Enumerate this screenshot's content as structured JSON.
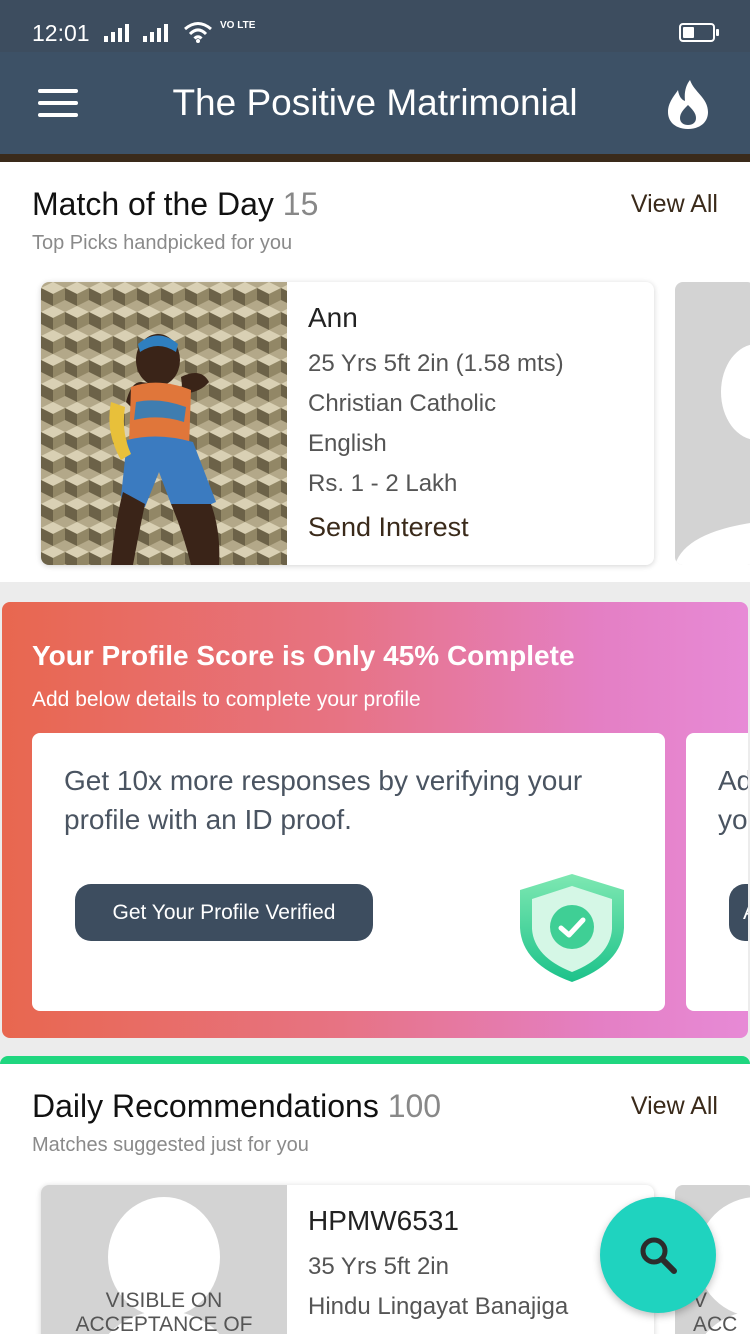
{
  "status_bar": {
    "time": "12:01",
    "network_label": "VO LTE",
    "battery_level": 0.4
  },
  "header": {
    "title": "The Positive Matrimonial"
  },
  "match_of_day": {
    "title": "Match of the Day",
    "count": "15",
    "subtitle": "Top Picks handpicked for you",
    "view_all": "View All",
    "profile": {
      "name": "Ann",
      "age_height": "25 Yrs 5ft 2in (1.58 mts)",
      "religion": "Christian Catholic",
      "language": "English",
      "income": "Rs. 1 - 2 Lakh",
      "action": "Send Interest"
    }
  },
  "profile_score": {
    "title": "Your Profile Score is Only 45% Complete",
    "percent": 45,
    "subtitle": "Add below details to complete your profile",
    "card": {
      "text": "Get 10x more responses by verifying your profile with an ID proof.",
      "button": "Get Your Profile Verified"
    },
    "next_card": {
      "text": "Ad\nyo",
      "button": "A"
    }
  },
  "daily_recommendations": {
    "title": "Daily Recommendations",
    "count": "100",
    "subtitle": "Matches suggested just for you",
    "view_all": "View All",
    "profile": {
      "name": "HPMW6531",
      "age_height": "35 Yrs 5ft 2in",
      "community": "Hindu Lingayat Banajiga",
      "photo_notice": "VISIBLE ON ACCEPTANCE OF"
    },
    "next_photo_notice": "V ACC"
  },
  "colors": {
    "header": "#3d5166",
    "status_bar": "#3d4d5f",
    "banner_start": "#e8674f",
    "banner_end": "#e78ad6",
    "accent_green": "#1fd67f",
    "fab": "#1fd3bf"
  },
  "icons": {
    "menu": "menu-icon",
    "flame": "flame-icon",
    "shield": "shield-check-icon",
    "search": "search-icon"
  }
}
